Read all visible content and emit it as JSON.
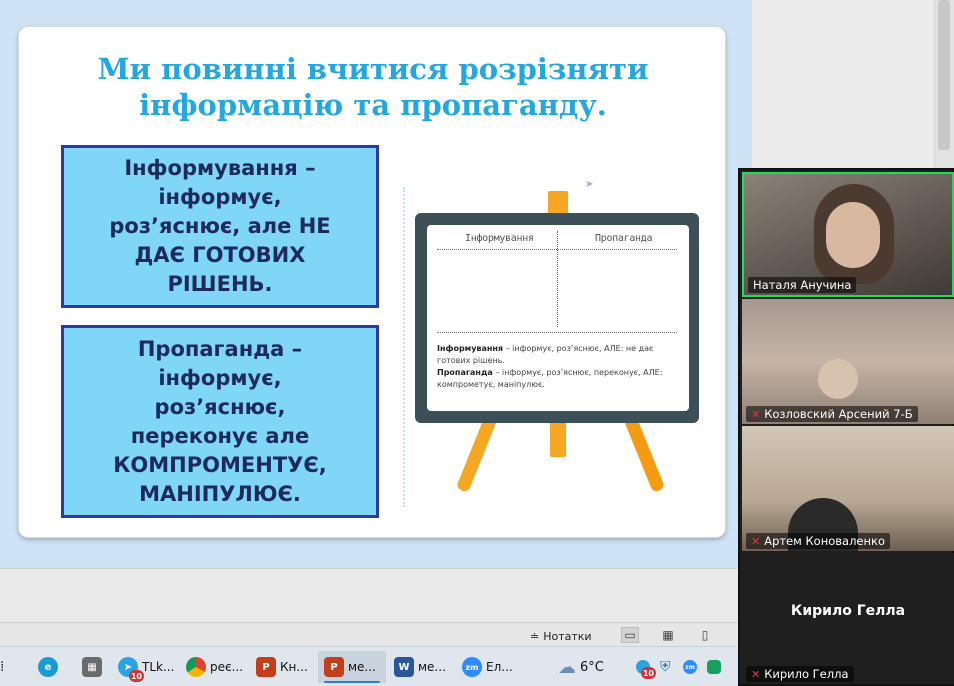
{
  "slide": {
    "title": "Ми повинні вчитися розрізняти інформацію та пропаганду.",
    "box1": "Інформування –\nінформує,\nроз’яснює, але НЕ\nДАЄ ГОТОВИХ\nРІШЕНЬ.",
    "box2": "Пропаганда –\nінформує,\nроз’яснює,\nпереконує але\nКОМПРОМЕНТУЄ,\nМАНІПУЛЮЄ.",
    "easel": {
      "col1": "Інформування",
      "col2": "Пропаганда",
      "def1_term": "Інформування",
      "def1_text": " – інформує, роз’яснює, АЛЕ: не дає готових рішень.",
      "def2_term": "Пропаганда",
      "def2_text": " – інформує, роз’яснює, переконує, АЛЕ: компрометує, маніпулює."
    }
  },
  "status_bar": {
    "notes_label": "Нотатки"
  },
  "zoom": {
    "participants": [
      {
        "name": "Наталя Анучина",
        "muted": false
      },
      {
        "name": "Козловский Арсений 7-Б",
        "muted": true
      },
      {
        "name": "Артем Коноваленко",
        "muted": true
      },
      {
        "name": "Кирило Гелла",
        "muted": true,
        "video": false
      }
    ],
    "no_video_name": "Кирило Гелла"
  },
  "taskbar": {
    "items": [
      {
        "label": "TLk...",
        "icon": "telegram-icon",
        "badge": "10"
      },
      {
        "label": "реє...",
        "icon": "chrome-icon"
      },
      {
        "label": "Кн...",
        "icon": "powerpoint-icon"
      },
      {
        "label": "ме...",
        "icon": "powerpoint-icon",
        "active": true
      },
      {
        "label": "ме...",
        "icon": "word-icon"
      },
      {
        "label": "Ел...",
        "icon": "zoom-icon"
      }
    ],
    "weather": "6°C",
    "tray_badge": "10"
  },
  "colors": {
    "title": "#23a7e0",
    "box_fill": "#7fd6f7",
    "box_border": "#2f3aa0",
    "zoom_active_border": "#23d959"
  }
}
